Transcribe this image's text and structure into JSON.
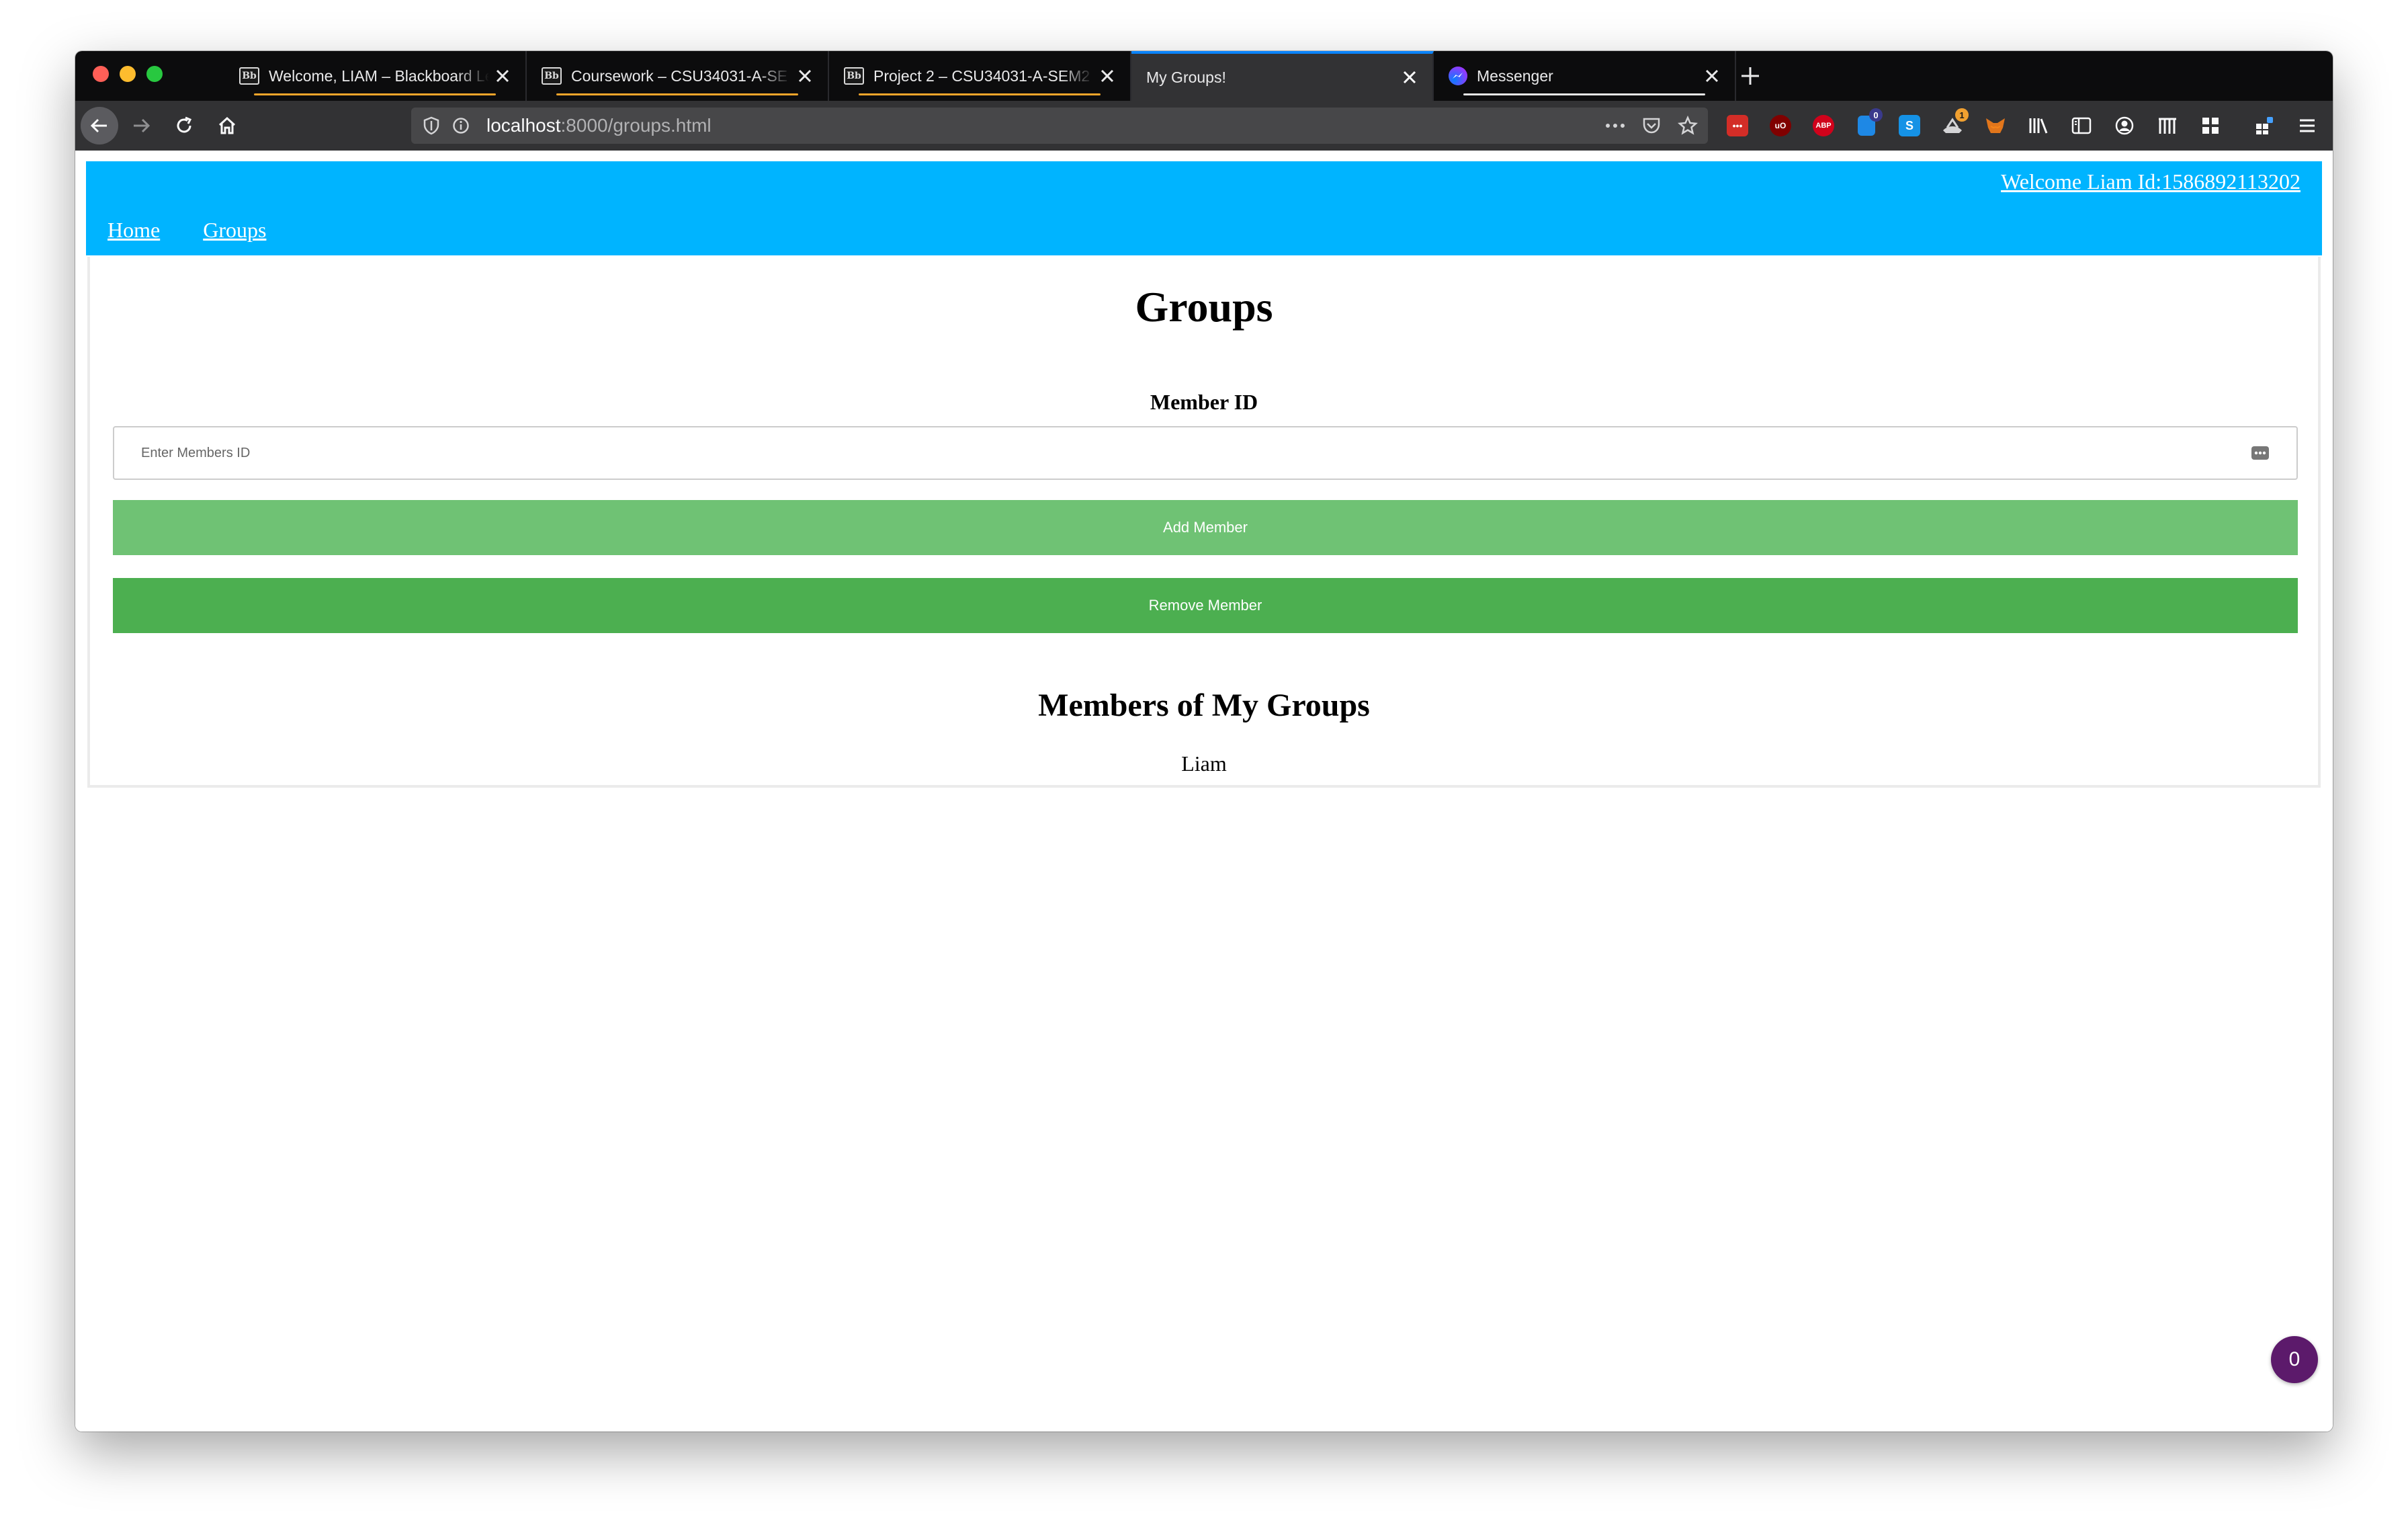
{
  "browser": {
    "tabs": [
      {
        "label": "Welcome, LIAM – Blackboard Le",
        "icon": "blackboard-icon",
        "active": false
      },
      {
        "label": "Coursework – CSU34031-A-SE",
        "icon": "blackboard-icon",
        "active": false
      },
      {
        "label": "Project 2 – CSU34031-A-SEM2",
        "icon": "blackboard-icon",
        "active": false
      },
      {
        "label": "My Groups!",
        "icon": "none",
        "active": true
      },
      {
        "label": "Messenger",
        "icon": "messenger-icon",
        "active": false
      }
    ],
    "url": {
      "host": "localhost",
      "path": ":8000/groups.html"
    },
    "badges": {
      "extension_a": "0",
      "extension_b": "1"
    },
    "extension_labels": {
      "ublock": "uO",
      "adblock": "ABP",
      "s": "S"
    }
  },
  "site": {
    "welcome": "Welcome Liam Id:1586892113202",
    "nav": {
      "home": "Home",
      "groups": "Groups"
    }
  },
  "main": {
    "title": "Groups",
    "member_id_label": "Member ID",
    "member_id_placeholder": "Enter Members ID",
    "add_button": "Add Member",
    "remove_button": "Remove Member",
    "members_title": "Members of My Groups",
    "members": [
      "Liam"
    ]
  },
  "chat_widget": {
    "count": "0"
  },
  "colors": {
    "header_bg": "#00b4ff",
    "add_button": "#6fc274",
    "remove_button": "#4caf50",
    "chat_bubble": "#5c1a6b",
    "tab_accent": "#f4a52a"
  }
}
